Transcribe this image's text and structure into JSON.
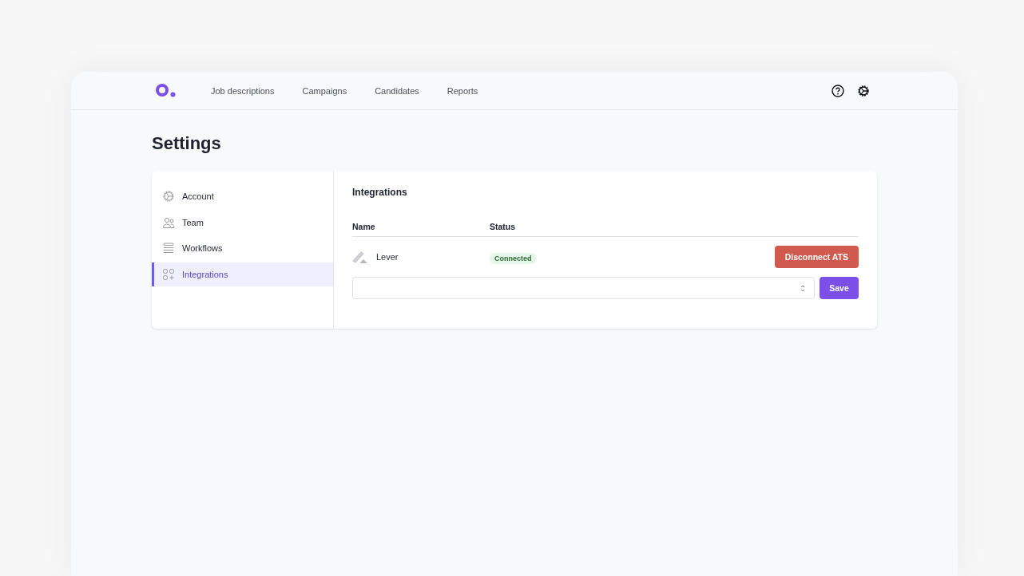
{
  "nav": {
    "links": [
      "Job descriptions",
      "Campaigns",
      "Candidates",
      "Reports"
    ]
  },
  "page": {
    "title": "Settings"
  },
  "sidebar": {
    "items": [
      {
        "label": "Account",
        "selected": false
      },
      {
        "label": "Team",
        "selected": false
      },
      {
        "label": "Workflows",
        "selected": false
      },
      {
        "label": "Integrations",
        "selected": true
      }
    ]
  },
  "integrations": {
    "title": "Integrations",
    "columns": [
      "Name",
      "Status"
    ],
    "rows": [
      {
        "name": "Lever",
        "status": "Connected",
        "action": "Disconnect ATS"
      }
    ],
    "save_button": "Save"
  }
}
